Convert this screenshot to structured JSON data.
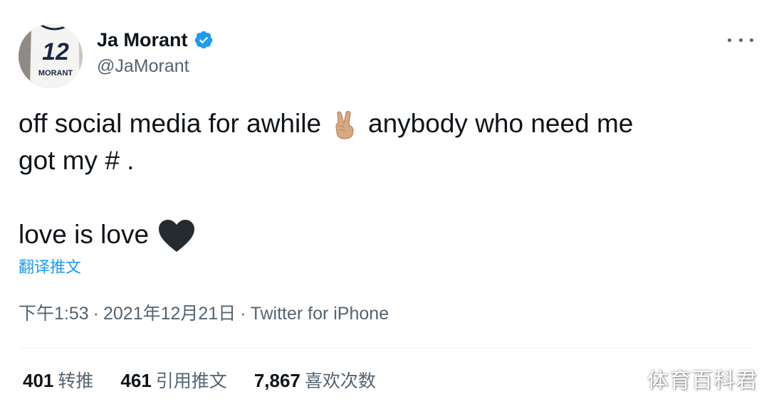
{
  "author": {
    "display_name": "Ja Morant",
    "handle": "@JaMorant",
    "avatar": {
      "jersey_number": "12",
      "jersey_name": "MORANT"
    },
    "verified_icon": "verified-badge-icon"
  },
  "tweet": {
    "line1_part1": "off social media for awhile",
    "line1_emoji": "victory-hand-emoji",
    "line1_part2": "anybody who need me",
    "line2": "got my # .",
    "line3": "love is love",
    "line3_emoji": "black-heart-emoji"
  },
  "translate_link": "翻译推文",
  "meta": {
    "time": "下午1:53",
    "date": "2021年12月21日",
    "source": "Twitter for iPhone",
    "separator": "·"
  },
  "stats": [
    {
      "count": "401",
      "label": "转推"
    },
    {
      "count": "461",
      "label": "引用推文"
    },
    {
      "count": "7,867",
      "label": "喜欢次数"
    }
  ],
  "watermark": "体育百科君",
  "colors": {
    "text": "#0f1419",
    "secondary": "#536471",
    "accent": "#1d9bf0",
    "divider": "#eff3f4"
  }
}
